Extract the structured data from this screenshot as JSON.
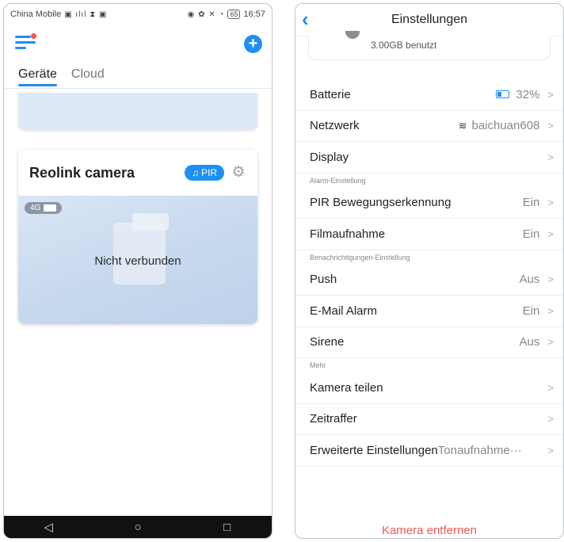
{
  "left": {
    "status": {
      "carrier": "China Mobile",
      "battery": "65",
      "time": "16:57"
    },
    "tabs": [
      {
        "label": "Geräte"
      },
      {
        "label": "Cloud"
      }
    ],
    "camera": {
      "name": "Reolink camera",
      "pir_label": "PIR",
      "signal": "4G",
      "message": "Nicht verbunden"
    }
  },
  "right": {
    "title": "Einstellungen",
    "storage": "3.00GB benutzt",
    "rows": [
      {
        "label": "Batterie",
        "value": "32%"
      },
      {
        "label": "Netzwerk",
        "value": "baichuan608"
      },
      {
        "label": "Display",
        "value": ""
      },
      {
        "section": "Alarm-Einstellung"
      },
      {
        "label": "PIR Bewegungserkennung",
        "value": "Ein"
      },
      {
        "label": "Filmaufnahme",
        "value": "Ein"
      },
      {
        "section": "Benachrichtigungen-Einstellung"
      },
      {
        "label": "Push",
        "value": "Aus"
      },
      {
        "label": "E-Mail Alarm",
        "value": "Ein"
      },
      {
        "label": "Sirene",
        "value": "Aus"
      },
      {
        "section": "Mehr"
      },
      {
        "label": "Kamera teilen",
        "value": ""
      },
      {
        "label": "Zeitraffer",
        "value": ""
      },
      {
        "label": "Erweiterte Einstellungen",
        "value": "Tonaufnahme···"
      }
    ],
    "remove_label": "Kamera entfernen"
  },
  "colors": {
    "accent": "#1e8ff5",
    "danger": "#f25a5a"
  }
}
